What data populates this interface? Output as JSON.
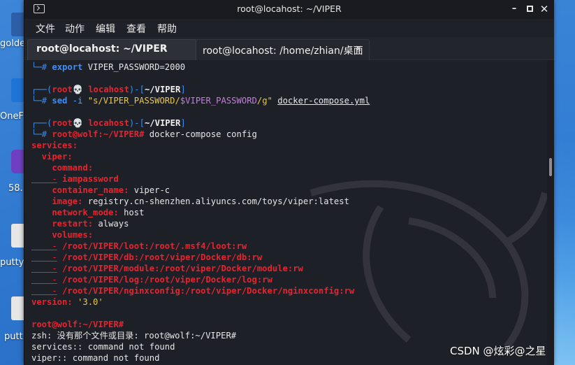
{
  "desktop": {
    "labels": [
      "golder",
      "OneF",
      "58.",
      "putty",
      "putt"
    ]
  },
  "window": {
    "title": "root@locahost: ~/VIPER",
    "controls": {
      "minimize": "–",
      "close": "✕"
    }
  },
  "menu": {
    "items": [
      "文件",
      "动作",
      "编辑",
      "查看",
      "帮助"
    ]
  },
  "tabs": [
    {
      "label": "root@locahost: ~/VIPER",
      "close": "×"
    },
    {
      "label": "root@locahost: /home/zhian/桌面",
      "close": "×"
    }
  ],
  "terminal": {
    "l1_prompt": "└─# ",
    "l1_kw": "export",
    "l1_rest": " VIPER_PASSWORD=2000",
    "l3_a": "┌──(",
    "l3_user": "root💀 locahost",
    "l3_b": ")-[",
    "l3_dir": "~/VIPER",
    "l3_c": "]",
    "l4_prompt": "└─# ",
    "l4_cmd": "sed",
    "l4_flag": " -i ",
    "l4_str1": "\"s/VIPER_PASSWORD/",
    "l4_var": "$VIPER_PASSWORD",
    "l4_str2": "/g\"",
    "l4_file": "docker-compose.yml",
    "l6_a": "┌──(",
    "l6_user": "root💀 locahost",
    "l6_b": ")-[",
    "l6_dir": "~/VIPER",
    "l6_c": "]",
    "l7_prompt": "└─# ",
    "l7_host": "root@wolf:~/VIPER#",
    "l7_cmd": " docker-compose config",
    "y_services": "services:",
    "y_viper": "  viper:",
    "y_command": "    command:",
    "y_cmd_dash": "    -",
    "y_cmd_val": " iampassword",
    "y_cname_k": "    container_name:",
    "y_cname_v": " viper-c",
    "y_image_k": "    image:",
    "y_image_v": " registry.cn-shenzhen.aliyuncs.com/toys/viper:latest",
    "y_net_k": "    network_mode:",
    "y_net_v": " host",
    "y_restart_k": "    restart:",
    "y_restart_v": " always",
    "y_volumes": "    volumes:",
    "vol_dash": "    -",
    "vols": [
      " /root/VIPER/loot:/root/.msf4/loot:rw",
      " /root/VIPER/db:/root/viper/Docker/db:rw",
      " /root/VIPER/module:/root/viper/Docker/module:rw",
      " /root/VIPER/log:/root/viper/Docker/log:rw",
      " /root/VIPER/nginxconfig:/root/viper/Docker/nginxconfig:rw"
    ],
    "y_version_k": "version:",
    "y_version_v": " '3.0'",
    "p_host": "root@wolf:~/VIPER#",
    "err1": "zsh: 没有那个文件或目录: root@wolf:~/VIPER#",
    "err2": "services:: command not found",
    "err3": "viper:: command not found"
  },
  "watermark": "CSDN @炫彩@之星"
}
